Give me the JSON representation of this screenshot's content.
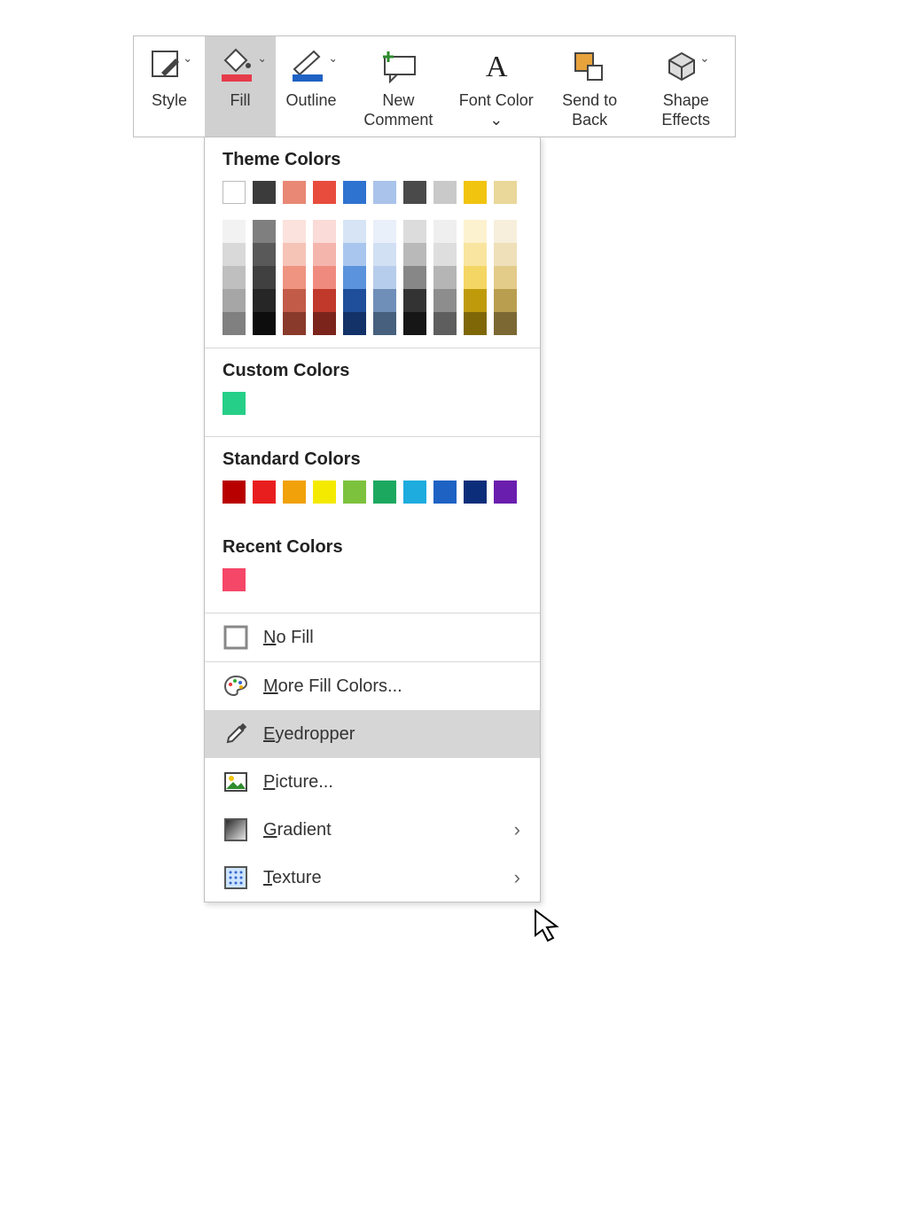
{
  "ribbon": {
    "items": [
      {
        "label": "Style"
      },
      {
        "label": "Fill"
      },
      {
        "label": "Outline"
      },
      {
        "label": "New Comment"
      },
      {
        "label": "Font Color ⌄"
      },
      {
        "label": "Send to Back"
      },
      {
        "label": "Shape Effects"
      }
    ]
  },
  "panel": {
    "themeTitle": "Theme Colors",
    "themeRow": [
      "#ffffff",
      "#3b3b3b",
      "#e98875",
      "#e84c3d",
      "#2f73d0",
      "#a9c3ea",
      "#4a4a4a",
      "#c9c9c9",
      "#f1c40f",
      "#ead79a"
    ],
    "shadeCols": [
      [
        "#f2f2f2",
        "#d9d9d9",
        "#bfbfbf",
        "#a6a6a6",
        "#808080"
      ],
      [
        "#7f7f7f",
        "#595959",
        "#404040",
        "#262626",
        "#0d0d0d"
      ],
      [
        "#fbe2dc",
        "#f6c3b7",
        "#ee9480",
        "#c25c48",
        "#8a3a2b"
      ],
      [
        "#fadbd7",
        "#f4b5ad",
        "#ef8b7e",
        "#c0392b",
        "#7b241c"
      ],
      [
        "#d6e4f6",
        "#a9c7ee",
        "#5b93dc",
        "#1f4e9b",
        "#133268"
      ],
      [
        "#e9f0fa",
        "#d2e0f4",
        "#b7cdec",
        "#6f8fb9",
        "#46607e"
      ],
      [
        "#dcdcdc",
        "#b9b9b9",
        "#878787",
        "#333333",
        "#161616"
      ],
      [
        "#efefef",
        "#dedede",
        "#b5b5b5",
        "#8d8d8d",
        "#5e5e5e"
      ],
      [
        "#fcf2cf",
        "#f9e59f",
        "#f4d664",
        "#bf9b0c",
        "#7f6708"
      ],
      [
        "#f7efdc",
        "#efe0ba",
        "#e3cb8a",
        "#b99e4f",
        "#7b6833"
      ]
    ],
    "customTitle": "Custom Colors",
    "customColors": [
      "#26cf87"
    ],
    "standardTitle": "Standard Colors",
    "standardColors": [
      "#b80000",
      "#e81e1e",
      "#f1a10a",
      "#f4ea00",
      "#7cc23d",
      "#1da860",
      "#1eabde",
      "#1e62c4",
      "#0c2e7a",
      "#6a1eae"
    ],
    "recentTitle": "Recent Colors",
    "recentColors": [
      "#f54768"
    ],
    "menu": {
      "noFill": "No Fill",
      "moreColors": "More Fill Colors...",
      "eyedropper": "Eyedropper",
      "picture": "Picture...",
      "gradient": "Gradient",
      "texture": "Texture"
    }
  }
}
